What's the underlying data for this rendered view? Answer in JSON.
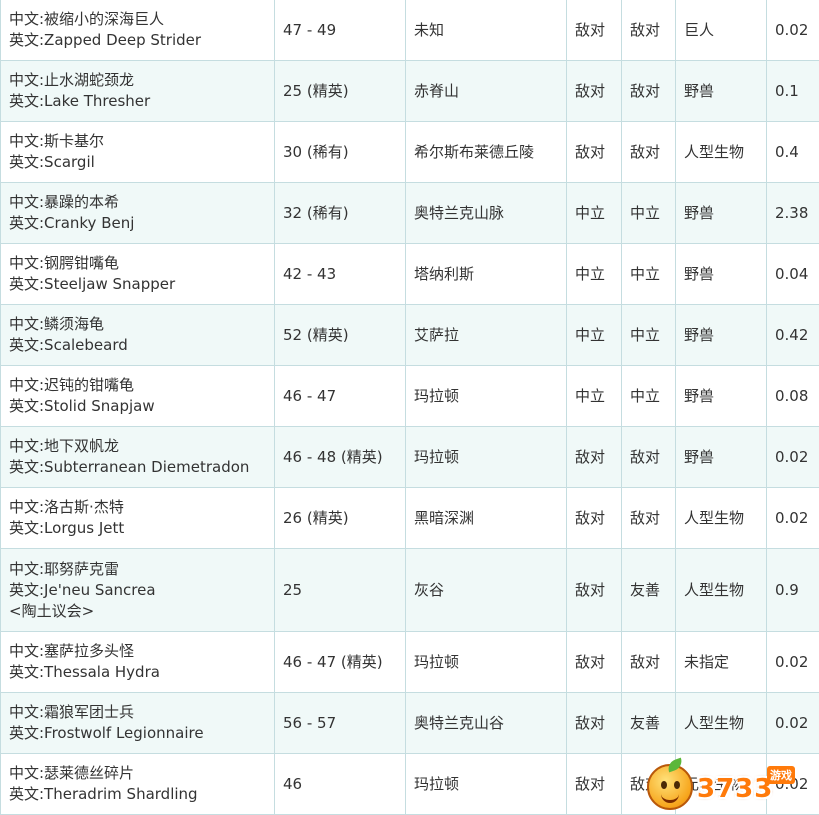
{
  "rows": [
    {
      "name_cn": "中文:被缩小的深海巨人",
      "name_en": "英文:Zapped Deep Strider",
      "title": "",
      "level": "47 - 49",
      "location": "未知",
      "faction1": "敌对",
      "faction2": "敌对",
      "type": "巨人",
      "value": "0.02"
    },
    {
      "name_cn": "中文:止水湖蛇颈龙",
      "name_en": "英文:Lake Thresher",
      "title": "",
      "level": "25 (精英)",
      "location": "赤脊山",
      "faction1": "敌对",
      "faction2": "敌对",
      "type": "野兽",
      "value": "0.1"
    },
    {
      "name_cn": "中文:斯卡基尔",
      "name_en": "英文:Scargil",
      "title": "",
      "level": "30 (稀有)",
      "location": "希尔斯布莱德丘陵",
      "faction1": "敌对",
      "faction2": "敌对",
      "type": "人型生物",
      "value": "0.4"
    },
    {
      "name_cn": "中文:暴躁的本希",
      "name_en": "英文:Cranky Benj",
      "title": "",
      "level": "32 (稀有)",
      "location": "奥特兰克山脉",
      "faction1": "中立",
      "faction2": "中立",
      "type": "野兽",
      "value": "2.38"
    },
    {
      "name_cn": "中文:钢腭钳嘴龟",
      "name_en": "英文:Steeljaw Snapper",
      "title": "",
      "level": "42 - 43",
      "location": "塔纳利斯",
      "faction1": "中立",
      "faction2": "中立",
      "type": "野兽",
      "value": "0.04"
    },
    {
      "name_cn": "中文:鳞须海龟",
      "name_en": "英文:Scalebeard",
      "title": "",
      "level": "52 (精英)",
      "location": "艾萨拉",
      "faction1": "中立",
      "faction2": "中立",
      "type": "野兽",
      "value": "0.42"
    },
    {
      "name_cn": "中文:迟钝的钳嘴龟",
      "name_en": "英文:Stolid Snapjaw",
      "title": "",
      "level": "46 - 47",
      "location": "玛拉顿",
      "faction1": "中立",
      "faction2": "中立",
      "type": "野兽",
      "value": "0.08"
    },
    {
      "name_cn": "中文:地下双帆龙",
      "name_en": "英文:Subterranean Diemetradon",
      "title": "",
      "level": "46 - 48 (精英)",
      "location": "玛拉顿",
      "faction1": "敌对",
      "faction2": "敌对",
      "type": "野兽",
      "value": "0.02"
    },
    {
      "name_cn": "中文:洛古斯·杰特",
      "name_en": "英文:Lorgus Jett",
      "title": "",
      "level": "26 (精英)",
      "location": "黑暗深渊",
      "faction1": "敌对",
      "faction2": "敌对",
      "type": "人型生物",
      "value": "0.02"
    },
    {
      "name_cn": "中文:耶努萨克雷",
      "name_en": "英文:Je'neu Sancrea",
      "title": "<陶土议会>",
      "level": "25",
      "location": "灰谷",
      "faction1": "敌对",
      "faction2": "友善",
      "type": "人型生物",
      "value": "0.9"
    },
    {
      "name_cn": "中文:塞萨拉多头怪",
      "name_en": "英文:Thessala Hydra",
      "title": "",
      "level": "46 - 47 (精英)",
      "location": "玛拉顿",
      "faction1": "敌对",
      "faction2": "敌对",
      "type": "未指定",
      "value": "0.02"
    },
    {
      "name_cn": "中文:霜狼军团士兵",
      "name_en": "英文:Frostwolf Legionnaire",
      "title": "",
      "level": "56 - 57",
      "location": "奥特兰克山谷",
      "faction1": "敌对",
      "faction2": "友善",
      "type": "人型生物",
      "value": "0.02"
    },
    {
      "name_cn": "中文:瑟莱德丝碎片",
      "name_en": "英文:Theradrim Shardling",
      "title": "",
      "level": "46",
      "location": "玛拉顿",
      "faction1": "敌对",
      "faction2": "敌对",
      "type": "元素生物",
      "value": "0.02"
    }
  ],
  "watermark": {
    "text": "3733",
    "sub": "游戏",
    "icon": "orange-mascot-icon"
  }
}
